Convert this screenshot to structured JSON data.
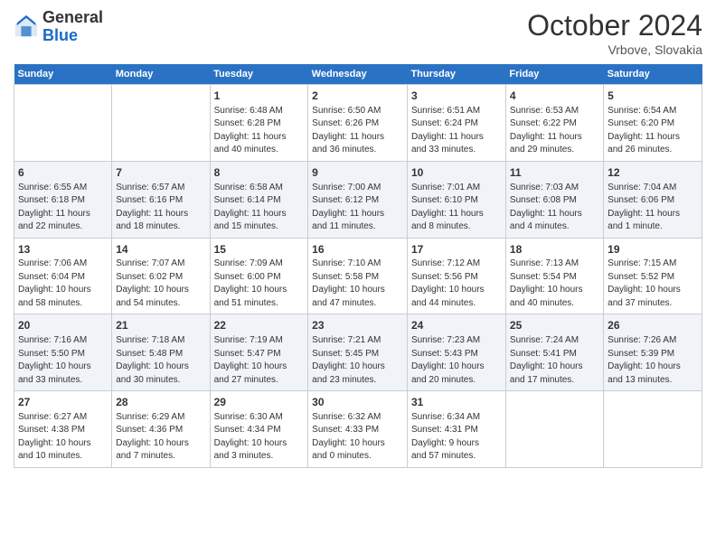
{
  "header": {
    "logo_general": "General",
    "logo_blue": "Blue",
    "month_title": "October 2024",
    "location": "Vrbove, Slovakia"
  },
  "weekdays": [
    "Sunday",
    "Monday",
    "Tuesday",
    "Wednesday",
    "Thursday",
    "Friday",
    "Saturday"
  ],
  "weeks": [
    [
      {
        "day": "",
        "content": ""
      },
      {
        "day": "",
        "content": ""
      },
      {
        "day": "1",
        "content": "Sunrise: 6:48 AM\nSunset: 6:28 PM\nDaylight: 11 hours\nand 40 minutes."
      },
      {
        "day": "2",
        "content": "Sunrise: 6:50 AM\nSunset: 6:26 PM\nDaylight: 11 hours\nand 36 minutes."
      },
      {
        "day": "3",
        "content": "Sunrise: 6:51 AM\nSunset: 6:24 PM\nDaylight: 11 hours\nand 33 minutes."
      },
      {
        "day": "4",
        "content": "Sunrise: 6:53 AM\nSunset: 6:22 PM\nDaylight: 11 hours\nand 29 minutes."
      },
      {
        "day": "5",
        "content": "Sunrise: 6:54 AM\nSunset: 6:20 PM\nDaylight: 11 hours\nand 26 minutes."
      }
    ],
    [
      {
        "day": "6",
        "content": "Sunrise: 6:55 AM\nSunset: 6:18 PM\nDaylight: 11 hours\nand 22 minutes."
      },
      {
        "day": "7",
        "content": "Sunrise: 6:57 AM\nSunset: 6:16 PM\nDaylight: 11 hours\nand 18 minutes."
      },
      {
        "day": "8",
        "content": "Sunrise: 6:58 AM\nSunset: 6:14 PM\nDaylight: 11 hours\nand 15 minutes."
      },
      {
        "day": "9",
        "content": "Sunrise: 7:00 AM\nSunset: 6:12 PM\nDaylight: 11 hours\nand 11 minutes."
      },
      {
        "day": "10",
        "content": "Sunrise: 7:01 AM\nSunset: 6:10 PM\nDaylight: 11 hours\nand 8 minutes."
      },
      {
        "day": "11",
        "content": "Sunrise: 7:03 AM\nSunset: 6:08 PM\nDaylight: 11 hours\nand 4 minutes."
      },
      {
        "day": "12",
        "content": "Sunrise: 7:04 AM\nSunset: 6:06 PM\nDaylight: 11 hours\nand 1 minute."
      }
    ],
    [
      {
        "day": "13",
        "content": "Sunrise: 7:06 AM\nSunset: 6:04 PM\nDaylight: 10 hours\nand 58 minutes."
      },
      {
        "day": "14",
        "content": "Sunrise: 7:07 AM\nSunset: 6:02 PM\nDaylight: 10 hours\nand 54 minutes."
      },
      {
        "day": "15",
        "content": "Sunrise: 7:09 AM\nSunset: 6:00 PM\nDaylight: 10 hours\nand 51 minutes."
      },
      {
        "day": "16",
        "content": "Sunrise: 7:10 AM\nSunset: 5:58 PM\nDaylight: 10 hours\nand 47 minutes."
      },
      {
        "day": "17",
        "content": "Sunrise: 7:12 AM\nSunset: 5:56 PM\nDaylight: 10 hours\nand 44 minutes."
      },
      {
        "day": "18",
        "content": "Sunrise: 7:13 AM\nSunset: 5:54 PM\nDaylight: 10 hours\nand 40 minutes."
      },
      {
        "day": "19",
        "content": "Sunrise: 7:15 AM\nSunset: 5:52 PM\nDaylight: 10 hours\nand 37 minutes."
      }
    ],
    [
      {
        "day": "20",
        "content": "Sunrise: 7:16 AM\nSunset: 5:50 PM\nDaylight: 10 hours\nand 33 minutes."
      },
      {
        "day": "21",
        "content": "Sunrise: 7:18 AM\nSunset: 5:48 PM\nDaylight: 10 hours\nand 30 minutes."
      },
      {
        "day": "22",
        "content": "Sunrise: 7:19 AM\nSunset: 5:47 PM\nDaylight: 10 hours\nand 27 minutes."
      },
      {
        "day": "23",
        "content": "Sunrise: 7:21 AM\nSunset: 5:45 PM\nDaylight: 10 hours\nand 23 minutes."
      },
      {
        "day": "24",
        "content": "Sunrise: 7:23 AM\nSunset: 5:43 PM\nDaylight: 10 hours\nand 20 minutes."
      },
      {
        "day": "25",
        "content": "Sunrise: 7:24 AM\nSunset: 5:41 PM\nDaylight: 10 hours\nand 17 minutes."
      },
      {
        "day": "26",
        "content": "Sunrise: 7:26 AM\nSunset: 5:39 PM\nDaylight: 10 hours\nand 13 minutes."
      }
    ],
    [
      {
        "day": "27",
        "content": "Sunrise: 6:27 AM\nSunset: 4:38 PM\nDaylight: 10 hours\nand 10 minutes."
      },
      {
        "day": "28",
        "content": "Sunrise: 6:29 AM\nSunset: 4:36 PM\nDaylight: 10 hours\nand 7 minutes."
      },
      {
        "day": "29",
        "content": "Sunrise: 6:30 AM\nSunset: 4:34 PM\nDaylight: 10 hours\nand 3 minutes."
      },
      {
        "day": "30",
        "content": "Sunrise: 6:32 AM\nSunset: 4:33 PM\nDaylight: 10 hours\nand 0 minutes."
      },
      {
        "day": "31",
        "content": "Sunrise: 6:34 AM\nSunset: 4:31 PM\nDaylight: 9 hours\nand 57 minutes."
      },
      {
        "day": "",
        "content": ""
      },
      {
        "day": "",
        "content": ""
      }
    ]
  ]
}
